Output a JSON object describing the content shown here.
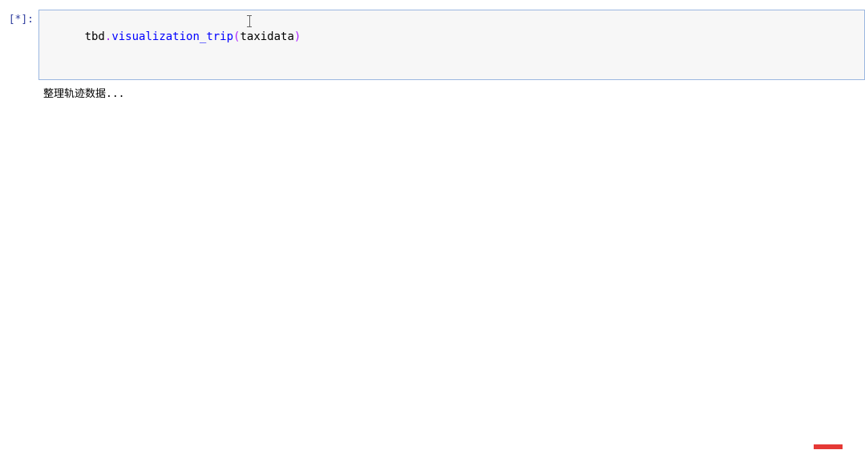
{
  "cell": {
    "prompt_open": "[",
    "prompt_status": "*",
    "prompt_close": "]:",
    "code": {
      "object": "tbd",
      "dot": ".",
      "function": "visualization_trip",
      "paren_open": "(",
      "argument": "taxidata",
      "paren_close": ")"
    }
  },
  "output": {
    "text": "整理轨迹数据..."
  }
}
